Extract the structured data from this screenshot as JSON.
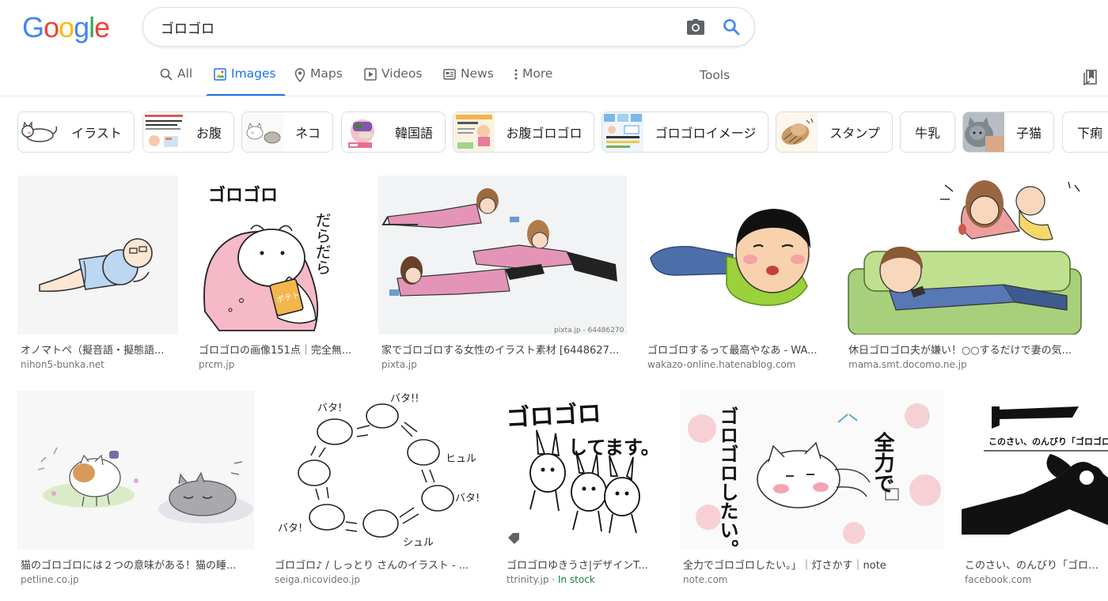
{
  "logo": {
    "text": "Google",
    "letters": [
      "G",
      "o",
      "o",
      "g",
      "l",
      "e"
    ],
    "colors": [
      "#4285F4",
      "#EA4335",
      "#FBBC05",
      "#4285F4",
      "#34A853",
      "#EA4335"
    ]
  },
  "search": {
    "query": "ゴロゴロ",
    "camera_icon": "camera-icon",
    "search_icon": "search-icon"
  },
  "tabs": [
    {
      "label": "All",
      "icon": "search-icon",
      "active": false
    },
    {
      "label": "Images",
      "icon": "image-icon",
      "active": true
    },
    {
      "label": "Maps",
      "icon": "map-pin-icon",
      "active": false
    },
    {
      "label": "Videos",
      "icon": "play-icon",
      "active": false
    },
    {
      "label": "News",
      "icon": "news-icon",
      "active": false
    },
    {
      "label": "More",
      "icon": "more-vert-icon",
      "active": false
    }
  ],
  "tools_label": "Tools",
  "accent_color": "#1a73e8",
  "chips": [
    {
      "label": "イラスト",
      "thumb": true
    },
    {
      "label": "お腹",
      "thumb": true
    },
    {
      "label": "ネコ",
      "thumb": true
    },
    {
      "label": "韓国語",
      "thumb": true
    },
    {
      "label": "お腹ゴロゴロ",
      "thumb": true
    },
    {
      "label": "ゴロゴロイメージ",
      "thumb": true
    },
    {
      "label": "スタンプ",
      "thumb": true
    },
    {
      "label": "牛乳",
      "thumb": false
    },
    {
      "label": "子猫",
      "thumb": true
    },
    {
      "label": "下痢",
      "thumb": false
    }
  ],
  "results_row1": [
    {
      "title": "オノマトペ（擬音語・擬態語...",
      "source": "nihon5-bunka.net"
    },
    {
      "title": "ゴロゴロの画像151点｜完全無...",
      "source": "prcm.jp"
    },
    {
      "title": "家でゴロゴロする女性のイラスト素材 [6448627...",
      "source": "pixta.jp",
      "watermark": "pixta.jp - 64486270"
    },
    {
      "title": "ゴロゴロするって最高やなあ - WA...",
      "source": "wakazo-online.hatenablog.com"
    },
    {
      "title": "休日ゴロゴロ夫が嫌い！○○するだけで妻の気...",
      "source": "mama.smt.docomo.ne.jp"
    }
  ],
  "results_row2": [
    {
      "title": "猫のゴロゴロには２つの意味がある！猫の睡...",
      "source": "petline.co.jp"
    },
    {
      "title": "ゴロゴロ♪ / しっとり さんのイラスト - ...",
      "source": "seiga.nicovideo.jp"
    },
    {
      "title": "ゴロゴロゆきうさ|デザインT...",
      "source": "ttrinity.jp",
      "source_sep": " · ",
      "stock": "In stock",
      "stock_color": "#188038"
    },
    {
      "title": "全力でゴロゴロしたい。」｜灯さかす｜note",
      "source": "note.com"
    },
    {
      "title": "このさい、のんびり「ゴロゴロ...",
      "source": "facebook.com",
      "image_text": "このさい、のんびり「ゴロゴロ」"
    }
  ],
  "image_texts": {
    "r1_2_main": "ゴロゴロ",
    "r1_2_side": "だらだら",
    "r1_2_bag": "ポテト",
    "r2_3_main": "ゴロゴロ",
    "r2_3_sub": "してます。",
    "r2_4_main": "ゴロゴロしたい。",
    "r2_4_right": "全力で"
  }
}
